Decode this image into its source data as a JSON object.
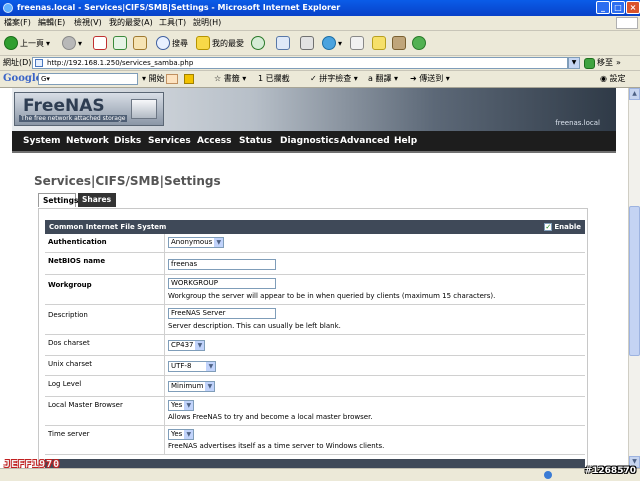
{
  "window": {
    "title": "freenas.local - Services|CIFS/SMB|Settings - Microsoft Internet Explorer",
    "controls": [
      "_",
      "□",
      "×"
    ]
  },
  "menubar": [
    "檔案(F)",
    "編輯(E)",
    "檢視(V)",
    "我的最愛(A)",
    "工具(T)",
    "說明(H)"
  ],
  "toolbar": {
    "back": "上一頁",
    "search": "搜尋",
    "favorites": "我的最愛"
  },
  "address": {
    "label": "網址(D)",
    "url": "http://192.168.1.250/services_samba.php",
    "go": "移至",
    "links": "»"
  },
  "googlebar": {
    "logo": "Google",
    "search_value": "G▾",
    "start": "開始",
    "bookmarks": "書籤",
    "blocked": "1 已攔截",
    "spellcheck": "拼字檢查",
    "translate": "翻譯",
    "send_to": "傳送到",
    "settings": "設定"
  },
  "freenas": {
    "logo": "FreeNAS",
    "tagline": "The free network attached storage",
    "hostname": "freenas.local",
    "nav": [
      "System",
      "Network",
      "Disks",
      "Services",
      "Access",
      "Status",
      "Diagnostics",
      "Advanced",
      "Help"
    ],
    "page_title": "Services|CIFS/SMB|Settings",
    "tabs": [
      "Settings",
      "Shares"
    ],
    "section": {
      "title": "Common Internet File System",
      "enable_label": "Enable",
      "enabled": true
    },
    "rows": [
      {
        "label": "Authentication",
        "value": "Anonymous",
        "desc": ""
      },
      {
        "label": "NetBIOS name",
        "value": "freenas",
        "desc": ""
      },
      {
        "label": "Workgroup",
        "value": "WORKGROUP",
        "desc": "Workgroup the server will appear to be in when queried by clients (maximum 15 characters)."
      },
      {
        "label": "Description",
        "value": "FreeNAS Server",
        "desc": "Server description. This can usually be left blank."
      },
      {
        "label": "Dos charset",
        "value": "CP437",
        "desc": ""
      },
      {
        "label": "Unix charset",
        "value": "UTF-8",
        "desc": ""
      },
      {
        "label": "Log Level",
        "value": "Minimum",
        "desc": ""
      },
      {
        "label": "Local Master Browser",
        "value": "Yes",
        "desc": "Allows FreeNAS to try and become a local master browser."
      },
      {
        "label": "Time server",
        "value": "Yes",
        "desc": "FreeNAS advertises itself as a time server to Windows clients."
      }
    ]
  },
  "watermarks": {
    "left": "JEFF1970",
    "right": "#1268570"
  }
}
